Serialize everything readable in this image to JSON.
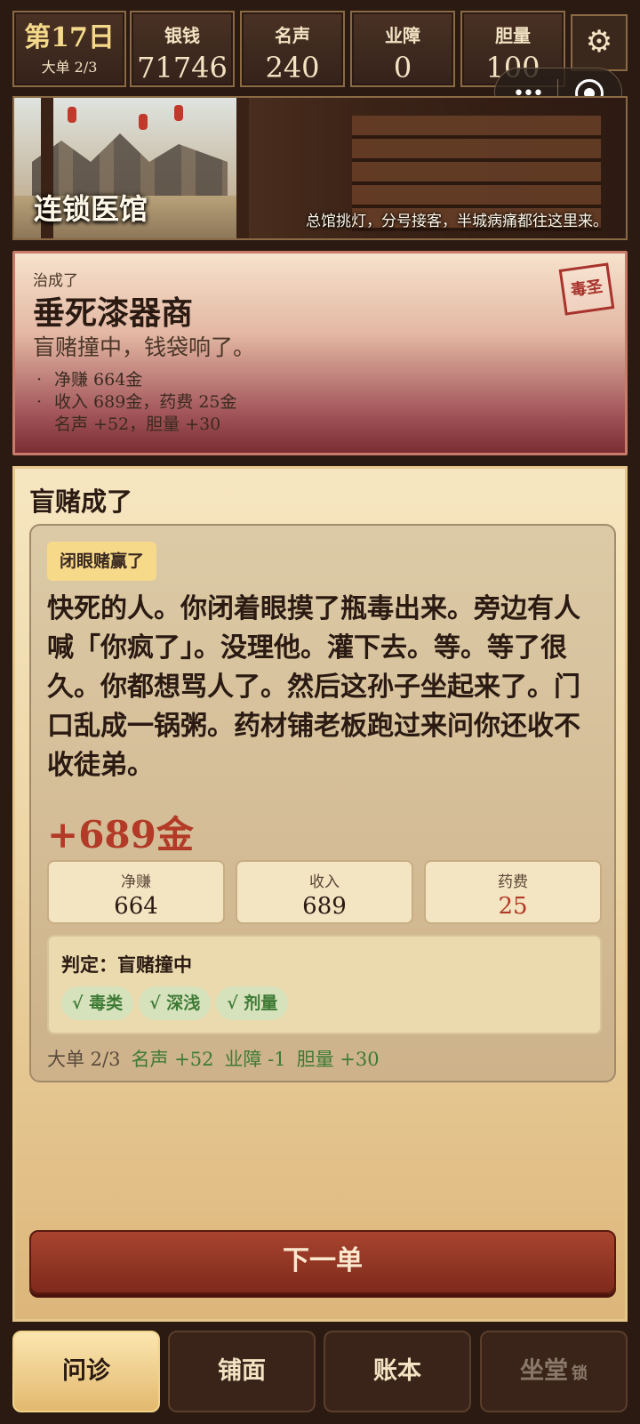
{
  "topbar": {
    "day": "第17日",
    "order_progress": "大单 2/3",
    "stats": [
      {
        "label": "银钱",
        "value": "71746"
      },
      {
        "label": "名声",
        "value": "240"
      },
      {
        "label": "业障",
        "value": "0"
      },
      {
        "label": "胆量",
        "value": "100"
      }
    ],
    "settings_icon": "gear-icon"
  },
  "banner": {
    "title": "连锁医馆",
    "subtitle": "总馆挑灯，分号接客，半城病痛都往这里来。"
  },
  "result": {
    "cured_label": "治成了",
    "patient": "垂死漆器商",
    "summary": "盲赌撞中，钱袋响了。",
    "bullets": [
      "净赚 664金",
      "收入 689金，药费 25金",
      "名声 +52，胆量 +30"
    ],
    "stamp": "毒圣"
  },
  "panel": {
    "title": "盲赌成了",
    "chip": "闭眼赌赢了",
    "story": "快死的人。你闭着眼摸了瓶毒出来。旁边有人喊「你疯了」。没理他。灌下去。等。等了很久。你都想骂人了。然后这孙子坐起来了。门口乱成一锅粥。药材铺老板跑过来问你还收不收徒弟。",
    "gain": "+689金",
    "boxes": [
      {
        "label": "净赚",
        "value": "664"
      },
      {
        "label": "收入",
        "value": "689"
      },
      {
        "label": "药费",
        "value": "25"
      }
    ],
    "verdict": "判定：盲赌撞中",
    "tags": [
      "√ 毒类",
      "√ 深浅",
      "√ 剂量"
    ],
    "footer": {
      "order": "大单 2/3",
      "fame": "名声 +52",
      "karma": "业障 -1",
      "courage": "胆量 +30"
    },
    "next_button": "下一单"
  },
  "tabs": [
    {
      "label": "问诊"
    },
    {
      "label": "铺面"
    },
    {
      "label": "账本"
    },
    {
      "label": "坐堂",
      "badge": "锁"
    }
  ],
  "colors": {
    "accent": "#b23a26",
    "positive": "#3e7a36",
    "frame": "#8a6a45"
  }
}
